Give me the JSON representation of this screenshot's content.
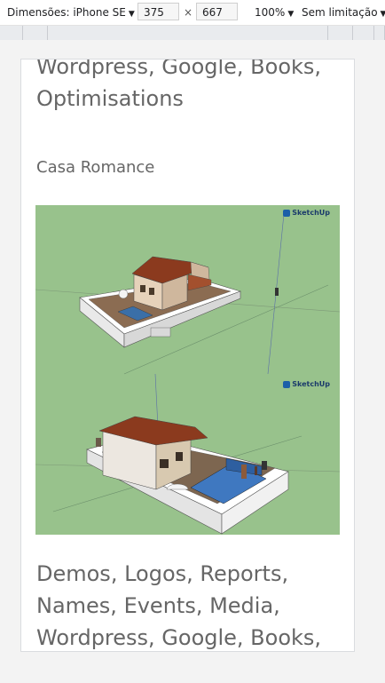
{
  "toolbar": {
    "device_label": "Dimensões: iPhone SE",
    "width": "375",
    "times": "×",
    "height": "667",
    "zoom": "100%",
    "throttle": "Sem limitação"
  },
  "page": {
    "tags_top": "Wordpress, Google, Books, Optimisations",
    "project_title": "Casa Romance",
    "image_labels": [
      "SketchUp",
      "SketchUp"
    ],
    "tags_bottom": "Demos, Logos, Reports, Names, Events, Media, Wordpress, Google, Books,"
  }
}
